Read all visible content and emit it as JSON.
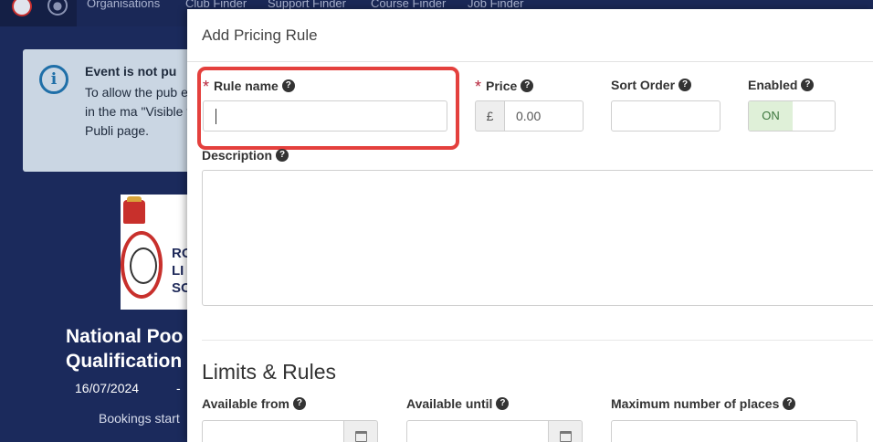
{
  "nav": {
    "links": [
      "Organisations",
      "Club Finder",
      "Support Finder",
      "Course Finder",
      "Job Finder"
    ]
  },
  "notice": {
    "title": "Event is not pu",
    "text": "To allow the pub event in the ma \"Visible to Publi page."
  },
  "logo": {
    "text_lines": [
      "RO",
      "LI",
      "SO"
    ]
  },
  "event": {
    "title_line1": "National Poo",
    "title_line2": "Qualification",
    "date": "16/07/2024",
    "separator": "-",
    "booking": "Bookings start"
  },
  "modal": {
    "title": "Add Pricing Rule",
    "rule_name": {
      "label": "Rule name",
      "required": "*",
      "help": "?",
      "value": ""
    },
    "price": {
      "label": "Price",
      "required": "*",
      "help": "?",
      "currency": "£",
      "value": "0.00"
    },
    "sort_order": {
      "label": "Sort Order",
      "help": "?",
      "value": ""
    },
    "enabled": {
      "label": "Enabled",
      "help": "?",
      "state": "ON"
    },
    "description": {
      "label": "Description",
      "help": "?",
      "value": ""
    },
    "limits": {
      "title": "Limits & Rules",
      "available_from": {
        "label": "Available from",
        "help": "?"
      },
      "available_until": {
        "label": "Available until",
        "help": "?"
      },
      "max_places": {
        "label": "Maximum number of places",
        "help": "?"
      }
    }
  },
  "colors": {
    "background": "#1b2a5c",
    "highlight": "#e4403d",
    "required": "#b7263c",
    "toggle_on": "#dff0d8"
  }
}
